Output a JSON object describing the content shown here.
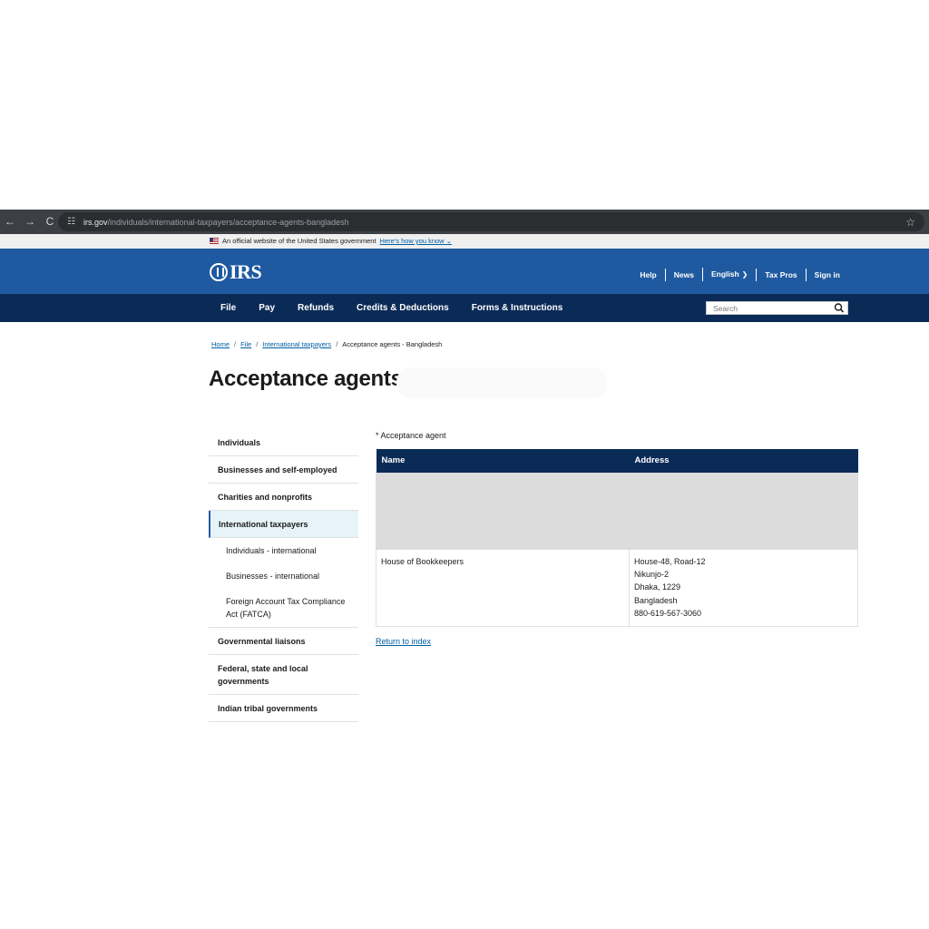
{
  "browser": {
    "back": "←",
    "forward": "→",
    "reload": "C",
    "url_host": "irs.gov",
    "url_path": "/individuals/international-taxpayers/acceptance-agents-bangladesh",
    "star": "☆"
  },
  "official_banner": {
    "text": "An official website of the United States government",
    "link": "Here's how you know",
    "chevron": "⌄"
  },
  "header": {
    "logo_text": "IRS",
    "utility_nav": [
      "Help",
      "News",
      "English",
      "Tax Pros",
      "Sign in"
    ]
  },
  "main_nav": {
    "items": [
      "File",
      "Pay",
      "Refunds",
      "Credits & Deductions",
      "Forms & Instructions"
    ],
    "search_placeholder": "Search"
  },
  "breadcrumb": {
    "items": [
      "Home",
      "File",
      "International taxpayers"
    ],
    "current": "Acceptance agents - Bangladesh"
  },
  "page": {
    "title": "Acceptance agents"
  },
  "sidebar": {
    "items": [
      {
        "label": "Individuals"
      },
      {
        "label": "Businesses and self-employed"
      },
      {
        "label": "Charities and nonprofits"
      },
      {
        "label": "International taxpayers",
        "active": true
      },
      {
        "label": "Individuals - international"
      },
      {
        "label": "Businesses - international"
      },
      {
        "label": "Foreign Account Tax Compliance Act (FATCA)"
      },
      {
        "label": "Governmental liaisons"
      },
      {
        "label": "Federal, state and local governments"
      },
      {
        "label": "Indian tribal governments"
      }
    ]
  },
  "content": {
    "note": "* Acceptance agent",
    "table": {
      "headers": [
        "Name",
        "Address"
      ],
      "rows": [
        {
          "name": "House of Bookkeepers",
          "address": [
            "House-48, Road-12",
            "Nikunjo-2",
            "Dhaka, 1229",
            "Bangladesh",
            "880-619-567-3060"
          ]
        }
      ]
    },
    "return_link": "Return to index"
  },
  "colors": {
    "header_blue": "#1f5aa0",
    "nav_navy": "#0b2b57",
    "link_blue": "#005ea2"
  }
}
